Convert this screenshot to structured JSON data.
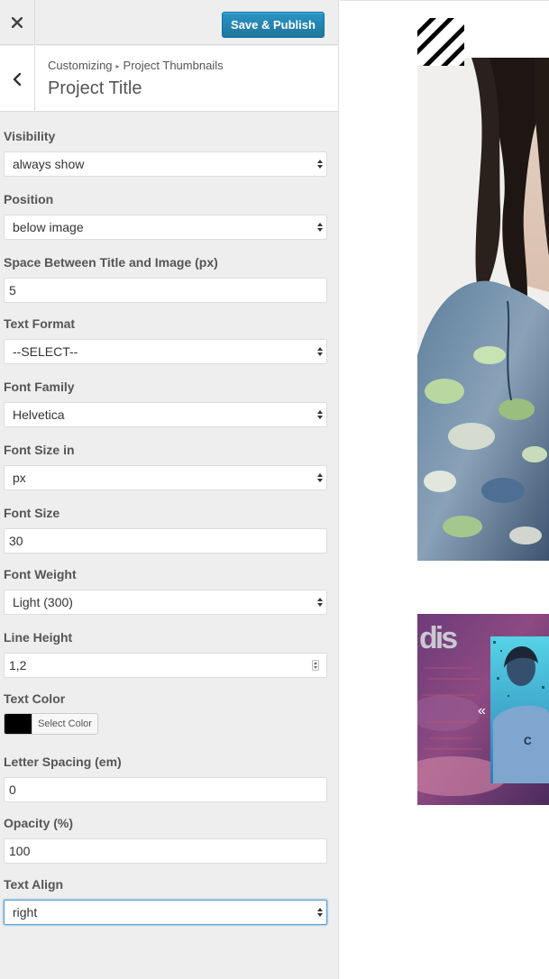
{
  "topbar": {
    "close_icon": "close-icon",
    "publish_label": "Save & Publish",
    "publish_color": "#1e8cbe"
  },
  "section": {
    "breadcrumb_root": "Customizing",
    "breadcrumb_separator": "▸",
    "breadcrumb_current": "Project Thumbnails",
    "title": "Project Title"
  },
  "fields": {
    "visibility": {
      "label": "Visibility",
      "value": "always show"
    },
    "position": {
      "label": "Position",
      "value": "below image"
    },
    "space": {
      "label": "Space Between Title and Image (px)",
      "value": "5"
    },
    "text_format": {
      "label": "Text Format",
      "value": "--SELECT--"
    },
    "font_family": {
      "label": "Font Family",
      "value": "Helvetica"
    },
    "font_size_in": {
      "label": "Font Size in",
      "value": "px"
    },
    "font_size": {
      "label": "Font Size",
      "value": "30"
    },
    "font_weight": {
      "label": "Font Weight",
      "value": "Light (300)"
    },
    "line_height": {
      "label": "Line Height",
      "value": "1,2"
    },
    "text_color": {
      "label": "Text Color",
      "button_label": "Select Color",
      "swatch": "#000000"
    },
    "letter_spacing": {
      "label": "Letter Spacing (em)",
      "value": "0"
    },
    "opacity": {
      "label": "Opacity (%)",
      "value": "100"
    },
    "text_align": {
      "label": "Text Align",
      "value": "right"
    }
  },
  "preview": {
    "logo_icon": "diagonal-stripes-logo-icon",
    "thumbnail_1": "portrait-photo-thumbnail",
    "thumbnail_2": "dis-magazine-collage-thumbnail",
    "thumbnail_2_logo_text": "dis",
    "thumbnail_2_arrow": "«"
  }
}
